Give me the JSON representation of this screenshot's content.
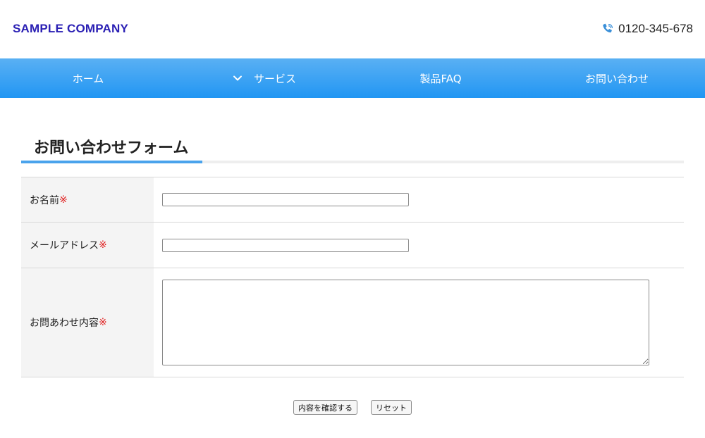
{
  "header": {
    "logo": "SAMPLE COMPANY",
    "phone": "0120-345-678",
    "phone_icon": "phone-icon"
  },
  "nav": {
    "items": [
      {
        "label": "ホーム"
      },
      {
        "label": "サービス",
        "icon": "chevron-down-icon"
      },
      {
        "label": "製品FAQ"
      },
      {
        "label": "お問い合わせ"
      }
    ]
  },
  "main": {
    "title": "お問い合わせフォーム",
    "fields": [
      {
        "label": "お名前",
        "required_mark": "※",
        "value": ""
      },
      {
        "label": "メールアドレス",
        "required_mark": "※",
        "value": ""
      },
      {
        "label": "お問あわせ内容",
        "required_mark": "※",
        "value": ""
      }
    ],
    "confirm_label": "内容を確認する",
    "reset_label": "リセット"
  },
  "colors": {
    "logo": "#2b20b4",
    "nav_top": "#5ab0f3",
    "nav_bottom": "#2196f3",
    "accent": "#4aa3ec",
    "required": "#e02020"
  }
}
